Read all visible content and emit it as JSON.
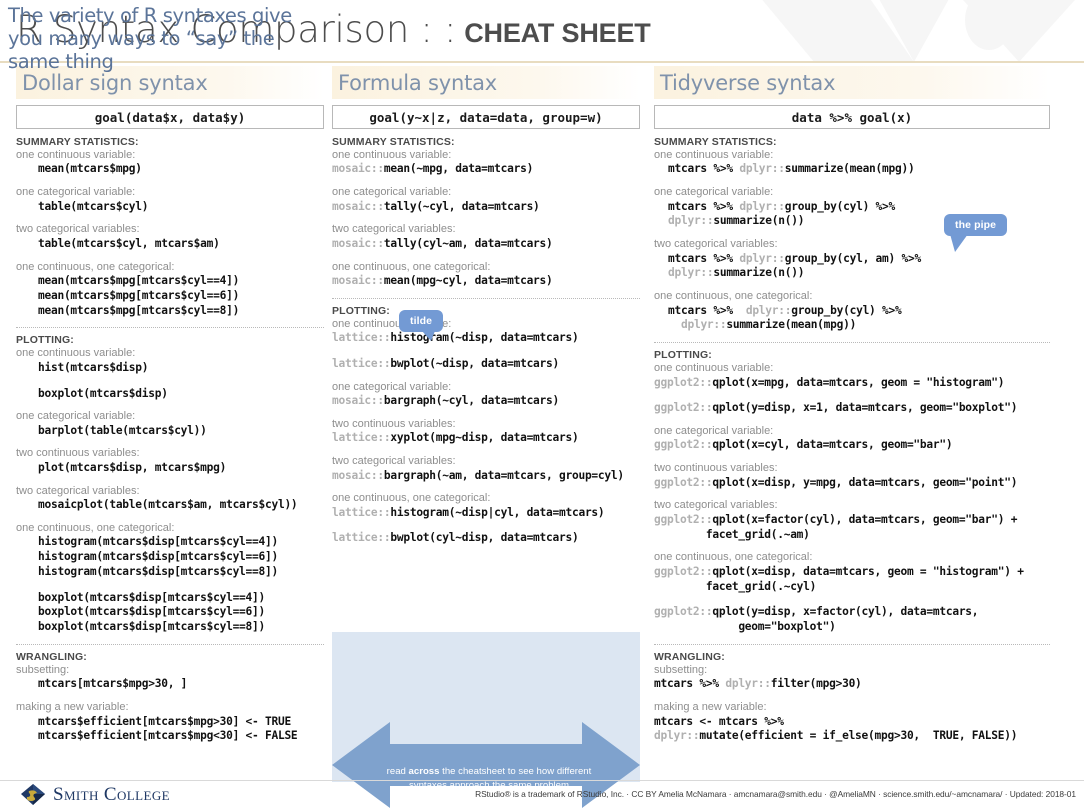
{
  "title": {
    "main": "R Syntax Comparison : :",
    "sub": "CHEAT SHEET"
  },
  "columns": [
    {
      "id": "dollar",
      "header": "Dollar sign syntax",
      "goal": "goal(data$x, data$y)",
      "sections": [
        {
          "title": "SUMMARY STATISTICS:",
          "cases": [
            {
              "label": "one continuous variable:",
              "lines": [
                "mean(mtcars$mpg)"
              ]
            },
            {
              "label": "one categorical variable:",
              "lines": [
                "table(mtcars$cyl)"
              ]
            },
            {
              "label": "two categorical variables:",
              "lines": [
                "table(mtcars$cyl, mtcars$am)"
              ]
            },
            {
              "label": "one continuous, one categorical:",
              "lines": [
                "mean(mtcars$mpg[mtcars$cyl==4])",
                "mean(mtcars$mpg[mtcars$cyl==6])",
                "mean(mtcars$mpg[mtcars$cyl==8])"
              ]
            }
          ]
        },
        {
          "title": "PLOTTING:",
          "cases": [
            {
              "label": "one continuous variable:",
              "lines": [
                "hist(mtcars$disp)",
                "",
                "boxplot(mtcars$disp)"
              ]
            },
            {
              "label": "one categorical variable:",
              "lines": [
                "barplot(table(mtcars$cyl))"
              ]
            },
            {
              "label": "two continuous variables:",
              "lines": [
                "plot(mtcars$disp, mtcars$mpg)"
              ]
            },
            {
              "label": "two categorical variables:",
              "lines": [
                "mosaicplot(table(mtcars$am, mtcars$cyl))"
              ]
            },
            {
              "label": "one continuous, one categorical:",
              "lines": [
                "histogram(mtcars$disp[mtcars$cyl==4])",
                "histogram(mtcars$disp[mtcars$cyl==6])",
                "histogram(mtcars$disp[mtcars$cyl==8])",
                "",
                "boxplot(mtcars$disp[mtcars$cyl==4])",
                "boxplot(mtcars$disp[mtcars$cyl==6])",
                "boxplot(mtcars$disp[mtcars$cyl==8])"
              ]
            }
          ]
        },
        {
          "title": "WRANGLING:",
          "cases": [
            {
              "label": "subsetting:",
              "lines": [
                "mtcars[mtcars$mpg>30, ]"
              ]
            },
            {
              "label": "making a new variable:",
              "lines": [
                "mtcars$efficient[mtcars$mpg>30] <- TRUE",
                "mtcars$efficient[mtcars$mpg<30] <- FALSE"
              ]
            }
          ]
        }
      ]
    },
    {
      "id": "formula",
      "header": "Formula syntax",
      "goal": "goal(y~x|z, data=data, group=w)",
      "sections": [
        {
          "title": "SUMMARY STATISTICS:",
          "cases": [
            {
              "label": "one continuous variable:",
              "lines": [
                {
                  "pkg": "mosaic::",
                  "fn": "mean(~mpg, data=mtcars)"
                }
              ]
            },
            {
              "label": "one categorical variable:",
              "lines": [
                {
                  "pkg": "mosaic::",
                  "fn": "tally(~cyl, data=mtcars)"
                }
              ]
            },
            {
              "label": "two categorical variables:",
              "lines": [
                {
                  "pkg": "mosaic::",
                  "fn": "tally(cyl~am, data=mtcars)"
                }
              ]
            },
            {
              "label": "one continuous, one categorical:",
              "lines": [
                {
                  "pkg": "mosaic::",
                  "fn": "mean(mpg~cyl, data=mtcars)"
                }
              ]
            }
          ]
        },
        {
          "title": "PLOTTING:",
          "cases": [
            {
              "label": "one continuous variable:",
              "lines": [
                {
                  "pkg": "lattice::",
                  "fn": "histogram(~disp, data=mtcars)"
                },
                "",
                {
                  "pkg": "lattice::",
                  "fn": "bwplot(~disp, data=mtcars)"
                }
              ]
            },
            {
              "label": "one categorical variable:",
              "lines": [
                {
                  "pkg": "mosaic::",
                  "fn": "bargraph(~cyl, data=mtcars)"
                }
              ]
            },
            {
              "label": "two continuous variables:",
              "lines": [
                {
                  "pkg": "lattice::",
                  "fn": "xyplot(mpg~disp, data=mtcars)"
                }
              ]
            },
            {
              "label": "two categorical variables:",
              "lines": [
                {
                  "pkg": "mosaic::",
                  "fn": "bargraph(~am, data=mtcars, group=cyl)"
                }
              ]
            },
            {
              "label": "one continuous, one categorical:",
              "lines": [
                {
                  "pkg": "lattice::",
                  "fn": "histogram(~disp|cyl, data=mtcars)"
                },
                "",
                {
                  "pkg": "lattice::",
                  "fn": "bwplot(cyl~disp, data=mtcars)"
                }
              ]
            }
          ]
        }
      ]
    },
    {
      "id": "tidyverse",
      "header": "Tidyverse syntax",
      "goal": "data %>% goal(x)",
      "sections": [
        {
          "title": "SUMMARY STATISTICS:",
          "cases": [
            {
              "label": "one continuous variable:",
              "indent": true,
              "lines": [
                {
                  "pre": "mtcars %>% ",
                  "pkg": "dplyr::",
                  "fn": "summarize(mean(mpg))"
                }
              ]
            },
            {
              "label": "one categorical variable:",
              "indent": true,
              "lines": [
                {
                  "pre": "mtcars %>% ",
                  "pkg": "dplyr::",
                  "fn": "group_by(cyl) %>%"
                },
                {
                  "pkg": "dplyr::",
                  "fn": "summarize(n())"
                }
              ]
            },
            {
              "label": "two categorical variables:",
              "indent": true,
              "lines": [
                {
                  "pre": "mtcars %>% ",
                  "pkg": "dplyr::",
                  "fn": "group_by(cyl, am) %>%"
                },
                {
                  "pkg": "dplyr::",
                  "fn": "summarize(n())"
                }
              ]
            },
            {
              "label": "one continuous, one categorical:",
              "indent": true,
              "lines": [
                {
                  "pre": "mtcars %>%  ",
                  "pkg": "dplyr::",
                  "fn": "group_by(cyl) %>%"
                },
                {
                  "pre": "  ",
                  "pkg": "dplyr::",
                  "fn": "summarize(mean(mpg))"
                }
              ]
            }
          ]
        },
        {
          "title": "PLOTTING:",
          "cases": [
            {
              "label": "one continuous variable:",
              "lines": [
                {
                  "pkg": "ggplot2::",
                  "fn": "qplot(x=mpg, data=mtcars, geom = \"histogram\")"
                },
                "",
                {
                  "pkg": "ggplot2::",
                  "fn": "qplot(y=disp, x=1, data=mtcars, geom=\"boxplot\")"
                }
              ]
            },
            {
              "label": "one categorical variable:",
              "lines": [
                {
                  "pkg": "ggplot2::",
                  "fn": "qplot(x=cyl, data=mtcars, geom=\"bar\")"
                }
              ]
            },
            {
              "label": "two continuous variables:",
              "lines": [
                {
                  "pkg": "ggplot2::",
                  "fn": "qplot(x=disp, y=mpg, data=mtcars, geom=\"point\")"
                }
              ]
            },
            {
              "label": "two categorical variables:",
              "lines": [
                {
                  "pkg": "ggplot2::",
                  "fn": "qplot(x=factor(cyl), data=mtcars, geom=\"bar\") +"
                },
                {
                  "pre": "        ",
                  "fn": "facet_grid(.~am)"
                }
              ]
            },
            {
              "label": "one continuous, one categorical:",
              "lines": [
                {
                  "pkg": "ggplot2::",
                  "fn": "qplot(x=disp, data=mtcars, geom = \"histogram\") +"
                },
                {
                  "pre": "        ",
                  "fn": "facet_grid(.~cyl)"
                },
                "",
                {
                  "pkg": "ggplot2::",
                  "fn": "qplot(y=disp, x=factor(cyl), data=mtcars,"
                },
                {
                  "pre": "             ",
                  "fn": "geom=\"boxplot\")"
                }
              ]
            }
          ]
        },
        {
          "title": "WRANGLING:",
          "cases": [
            {
              "label": "subsetting:",
              "lines": [
                {
                  "pre": "mtcars %>% ",
                  "pkg": "dplyr::",
                  "fn": "filter(mpg>30)"
                }
              ]
            },
            {
              "label": "making a new variable:",
              "lines": [
                {
                  "fn": "mtcars <- mtcars %>%"
                },
                {
                  "pkg": "dplyr::",
                  "fn": "mutate(efficient = if_else(mpg>30,  TRUE, FALSE))"
                }
              ]
            }
          ]
        }
      ]
    }
  ],
  "callouts": [
    {
      "id": "tilde",
      "label": "tilde"
    },
    {
      "id": "pipe",
      "label": "the pipe"
    }
  ],
  "banner": {
    "headline": "The variety of R syntaxes give you many ways to “say” the same thing",
    "arrow_label_pre": "read ",
    "arrow_label_bold": "across",
    "arrow_label_post": " the cheatsheet to see how different syntaxes approach the same problem"
  },
  "footer": {
    "logo_text": "Smith College",
    "credits": "RStudio® is a trademark of RStudio, Inc.  ·  CC BY Amelia McNamara · amcnamara@smith.edu · @AmeliaMN · science.smith.edu/~amcnamara/ · Updated: 2018-01"
  },
  "colors": {
    "header_cream": "#fbf2df",
    "header_text": "#7f92ab",
    "bubble_blue": "#739ad4",
    "banner_bg": "#dce6f2",
    "banner_text": "#5b7499",
    "arrow_blue": "#7fa2cd",
    "smith_navy": "#1f3864",
    "smith_gold": "#c8a93a",
    "code_gray": "#b0b0b0",
    "label_gray": "#8e8e8e"
  }
}
